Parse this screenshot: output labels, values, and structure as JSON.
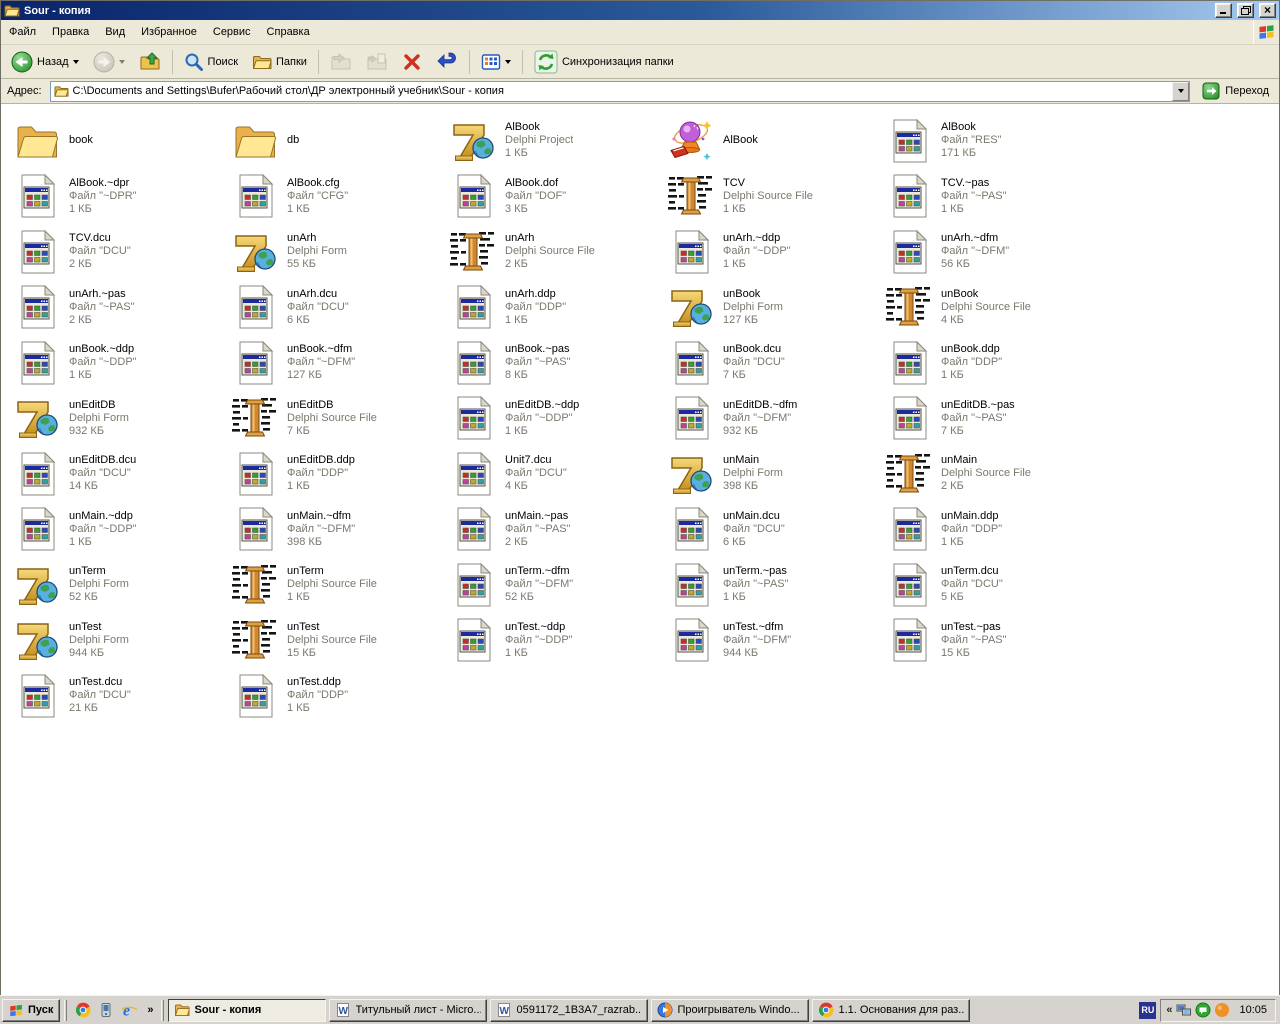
{
  "window": {
    "title": "Sour - копия"
  },
  "colors": {
    "titlebar_start": "#0A246A",
    "titlebar_end": "#A6CAF0",
    "chrome_bg": "#ECE9D8",
    "taskbar": "#D6D3CE",
    "field_border": "#7F9DB9"
  },
  "menu": {
    "items": [
      "Файл",
      "Правка",
      "Вид",
      "Избранное",
      "Сервис",
      "Справка"
    ]
  },
  "toolbar": {
    "back_label": "Назад",
    "search_label": "Поиск",
    "folders_label": "Папки",
    "sync_label": "Синхронизация папки"
  },
  "address": {
    "label": "Адрес:",
    "path": "C:\\Documents and Settings\\Bufer\\Рабочий стол\\ДР электронный учебник\\Sour - копия",
    "go_label": "Переход"
  },
  "files": [
    {
      "name": "book",
      "type": "",
      "size": "",
      "icon": "folder"
    },
    {
      "name": "db",
      "type": "",
      "size": "",
      "icon": "folder"
    },
    {
      "name": "AlBook",
      "type": "Delphi Project",
      "size": "1 КБ",
      "icon": "delphi7"
    },
    {
      "name": "AlBook",
      "type": "",
      "size": "",
      "icon": "crystal"
    },
    {
      "name": "AlBook",
      "type": "Файл \"RES\"",
      "size": "171 КБ",
      "icon": "file"
    },
    {
      "name": "AlBook.~dpr",
      "type": "Файл \"~DPR\"",
      "size": "1 КБ",
      "icon": "file"
    },
    {
      "name": "AlBook.cfg",
      "type": "Файл \"CFG\"",
      "size": "1 КБ",
      "icon": "file"
    },
    {
      "name": "AlBook.dof",
      "type": "Файл \"DOF\"",
      "size": "3 КБ",
      "icon": "file"
    },
    {
      "name": "TCV",
      "type": "Delphi Source File",
      "size": "1 КБ",
      "icon": "source"
    },
    {
      "name": "TCV.~pas",
      "type": "Файл \"~PAS\"",
      "size": "1 КБ",
      "icon": "file"
    },
    {
      "name": "TCV.dcu",
      "type": "Файл \"DCU\"",
      "size": "2 КБ",
      "icon": "file"
    },
    {
      "name": "unArh",
      "type": "Delphi Form",
      "size": "55 КБ",
      "icon": "delphi7"
    },
    {
      "name": "unArh",
      "type": "Delphi Source File",
      "size": "2 КБ",
      "icon": "source"
    },
    {
      "name": "unArh.~ddp",
      "type": "Файл \"~DDP\"",
      "size": "1 КБ",
      "icon": "file"
    },
    {
      "name": "unArh.~dfm",
      "type": "Файл \"~DFM\"",
      "size": "56 КБ",
      "icon": "file"
    },
    {
      "name": "unArh.~pas",
      "type": "Файл \"~PAS\"",
      "size": "2 КБ",
      "icon": "file"
    },
    {
      "name": "unArh.dcu",
      "type": "Файл \"DCU\"",
      "size": "6 КБ",
      "icon": "file"
    },
    {
      "name": "unArh.ddp",
      "type": "Файл \"DDP\"",
      "size": "1 КБ",
      "icon": "file"
    },
    {
      "name": "unBook",
      "type": "Delphi Form",
      "size": "127 КБ",
      "icon": "delphi7"
    },
    {
      "name": "unBook",
      "type": "Delphi Source File",
      "size": "4 КБ",
      "icon": "source"
    },
    {
      "name": "unBook.~ddp",
      "type": "Файл \"~DDP\"",
      "size": "1 КБ",
      "icon": "file"
    },
    {
      "name": "unBook.~dfm",
      "type": "Файл \"~DFM\"",
      "size": "127 КБ",
      "icon": "file"
    },
    {
      "name": "unBook.~pas",
      "type": "Файл \"~PAS\"",
      "size": "8 КБ",
      "icon": "file"
    },
    {
      "name": "unBook.dcu",
      "type": "Файл \"DCU\"",
      "size": "7 КБ",
      "icon": "file"
    },
    {
      "name": "unBook.ddp",
      "type": "Файл \"DDP\"",
      "size": "1 КБ",
      "icon": "file"
    },
    {
      "name": "unEditDB",
      "type": "Delphi Form",
      "size": "932 КБ",
      "icon": "delphi7"
    },
    {
      "name": "unEditDB",
      "type": "Delphi Source File",
      "size": "7 КБ",
      "icon": "source"
    },
    {
      "name": "unEditDB.~ddp",
      "type": "Файл \"~DDP\"",
      "size": "1 КБ",
      "icon": "file"
    },
    {
      "name": "unEditDB.~dfm",
      "type": "Файл \"~DFM\"",
      "size": "932 КБ",
      "icon": "file"
    },
    {
      "name": "unEditDB.~pas",
      "type": "Файл \"~PAS\"",
      "size": "7 КБ",
      "icon": "file"
    },
    {
      "name": "unEditDB.dcu",
      "type": "Файл \"DCU\"",
      "size": "14 КБ",
      "icon": "file"
    },
    {
      "name": "unEditDB.ddp",
      "type": "Файл \"DDP\"",
      "size": "1 КБ",
      "icon": "file"
    },
    {
      "name": "Unit7.dcu",
      "type": "Файл \"DCU\"",
      "size": "4 КБ",
      "icon": "file"
    },
    {
      "name": "unMain",
      "type": "Delphi Form",
      "size": "398 КБ",
      "icon": "delphi7"
    },
    {
      "name": "unMain",
      "type": "Delphi Source File",
      "size": "2 КБ",
      "icon": "source"
    },
    {
      "name": "unMain.~ddp",
      "type": "Файл \"~DDP\"",
      "size": "1 КБ",
      "icon": "file"
    },
    {
      "name": "unMain.~dfm",
      "type": "Файл \"~DFM\"",
      "size": "398 КБ",
      "icon": "file"
    },
    {
      "name": "unMain.~pas",
      "type": "Файл \"~PAS\"",
      "size": "2 КБ",
      "icon": "file"
    },
    {
      "name": "unMain.dcu",
      "type": "Файл \"DCU\"",
      "size": "6 КБ",
      "icon": "file"
    },
    {
      "name": "unMain.ddp",
      "type": "Файл \"DDP\"",
      "size": "1 КБ",
      "icon": "file"
    },
    {
      "name": "unTerm",
      "type": "Delphi Form",
      "size": "52 КБ",
      "icon": "delphi7"
    },
    {
      "name": "unTerm",
      "type": "Delphi Source File",
      "size": "1 КБ",
      "icon": "source"
    },
    {
      "name": "unTerm.~dfm",
      "type": "Файл \"~DFM\"",
      "size": "52 КБ",
      "icon": "file"
    },
    {
      "name": "unTerm.~pas",
      "type": "Файл \"~PAS\"",
      "size": "1 КБ",
      "icon": "file"
    },
    {
      "name": "unTerm.dcu",
      "type": "Файл \"DCU\"",
      "size": "5 КБ",
      "icon": "file"
    },
    {
      "name": "unTest",
      "type": "Delphi Form",
      "size": "944 КБ",
      "icon": "delphi7"
    },
    {
      "name": "unTest",
      "type": "Delphi Source File",
      "size": "15 КБ",
      "icon": "source"
    },
    {
      "name": "unTest.~ddp",
      "type": "Файл \"~DDP\"",
      "size": "1 КБ",
      "icon": "file"
    },
    {
      "name": "unTest.~dfm",
      "type": "Файл \"~DFM\"",
      "size": "944 КБ",
      "icon": "file"
    },
    {
      "name": "unTest.~pas",
      "type": "Файл \"~PAS\"",
      "size": "15 КБ",
      "icon": "file"
    },
    {
      "name": "unTest.dcu",
      "type": "Файл \"DCU\"",
      "size": "21 КБ",
      "icon": "file"
    },
    {
      "name": "unTest.ddp",
      "type": "Файл \"DDP\"",
      "size": "1 КБ",
      "icon": "file"
    }
  ],
  "taskbar": {
    "start_label": "Пуск",
    "overflow_chevron": "»",
    "quicklaunch": [
      {
        "icon": "chrome"
      },
      {
        "icon": "phone"
      },
      {
        "icon": "ie"
      }
    ],
    "tasks": [
      {
        "label": "Sour - копия",
        "icon": "tfolder",
        "active": true
      },
      {
        "label": "Титульный лист - Micro...",
        "icon": "word",
        "active": false
      },
      {
        "label": "0591172_1B3A7_razrab...",
        "icon": "word",
        "active": false
      },
      {
        "label": "Проигрыватель Windo...",
        "icon": "wmp",
        "active": false
      },
      {
        "label": "1.1. Основания для раз...",
        "icon": "chrome",
        "active": false
      }
    ],
    "tray": {
      "lang": "RU",
      "chevron": "«",
      "icons": [
        "network",
        "messenger",
        "orange"
      ],
      "clock": "10:05"
    }
  }
}
